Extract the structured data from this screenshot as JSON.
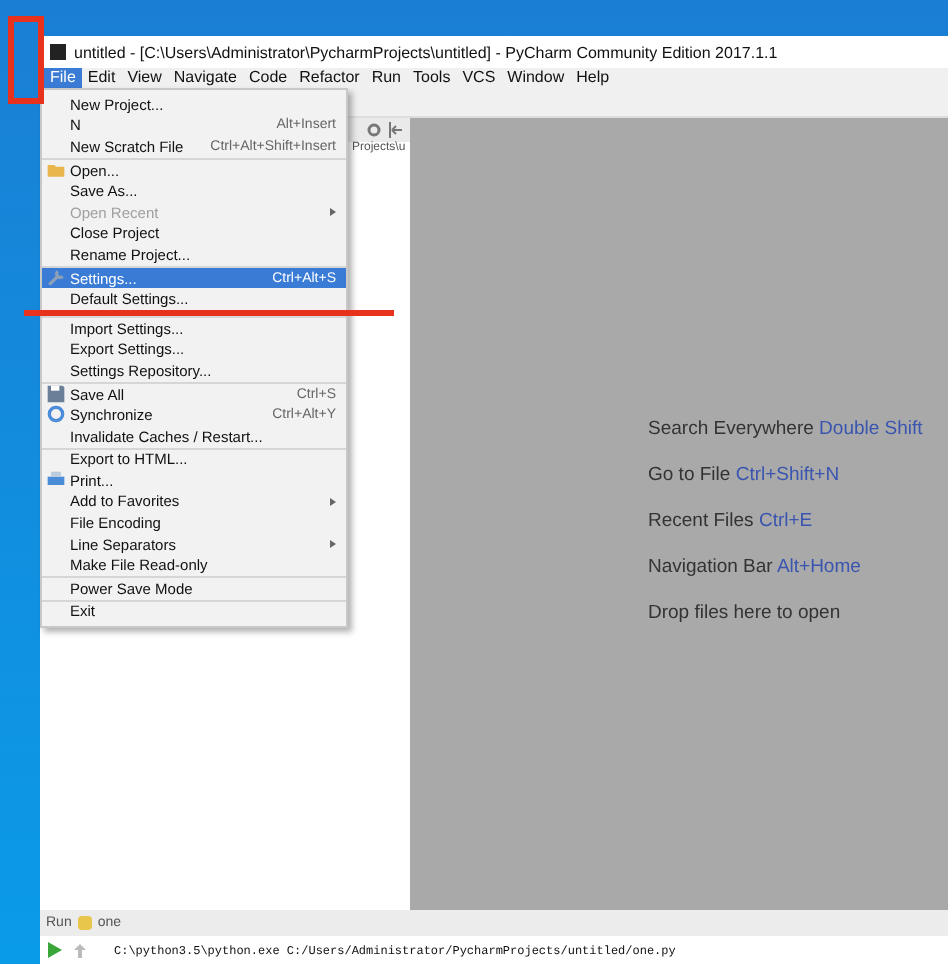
{
  "window": {
    "title": "untitled - [C:\\Users\\Administrator\\PycharmProjects\\untitled] - PyCharm Community Edition 2017.1.1"
  },
  "menubar": [
    {
      "label": "File",
      "selected": true
    },
    {
      "label": "Edit",
      "selected": false
    },
    {
      "label": "View",
      "selected": false
    },
    {
      "label": "Navigate",
      "selected": false
    },
    {
      "label": "Code",
      "selected": false
    },
    {
      "label": "Refactor",
      "selected": false
    },
    {
      "label": "Run",
      "selected": false
    },
    {
      "label": "Tools",
      "selected": false
    },
    {
      "label": "VCS",
      "selected": false
    },
    {
      "label": "Window",
      "selected": false
    },
    {
      "label": "Help",
      "selected": false
    }
  ],
  "file_menu": [
    {
      "items": [
        {
          "label": "New Project...",
          "selected": false,
          "disabled": false,
          "submenu": false
        },
        {
          "label": "N",
          "shortcut": "Alt+Insert",
          "selected": false,
          "disabled": false,
          "submenu": false
        },
        {
          "label": "New Scratch File",
          "shortcut": "Ctrl+Alt+Shift+Insert",
          "selected": false,
          "disabled": false,
          "submenu": false
        }
      ]
    },
    {
      "items": [
        {
          "label": "Open...",
          "selected": false,
          "disabled": false,
          "submenu": false
        },
        {
          "label": "Save As...",
          "selected": false,
          "disabled": false,
          "submenu": false
        },
        {
          "label": "Open Recent",
          "selected": false,
          "disabled": true,
          "submenu": true
        },
        {
          "label": "Close Project",
          "selected": false,
          "disabled": false,
          "submenu": false
        },
        {
          "label": "Rename Project...",
          "selected": false,
          "disabled": false,
          "submenu": false
        }
      ]
    },
    {
      "items": [
        {
          "label": "Settings...",
          "shortcut": "Ctrl+Alt+S",
          "selected": true,
          "disabled": false,
          "submenu": false
        },
        {
          "label": "Default Settings...",
          "selected": false,
          "disabled": false,
          "submenu": false
        }
      ]
    },
    {
      "items": [
        {
          "label": "Import Settings...",
          "selected": false,
          "disabled": false,
          "submenu": false
        },
        {
          "label": "Export Settings...",
          "selected": false,
          "disabled": false,
          "submenu": false
        },
        {
          "label": "Settings Repository...",
          "selected": false,
          "disabled": false,
          "submenu": false
        }
      ]
    },
    {
      "items": [
        {
          "label": "Save All",
          "shortcut": "Ctrl+S",
          "selected": false,
          "disabled": false,
          "submenu": false
        },
        {
          "label": "Synchronize",
          "shortcut": "Ctrl+Alt+Y",
          "selected": false,
          "disabled": false,
          "submenu": false
        },
        {
          "label": "Invalidate Caches / Restart...",
          "selected": false,
          "disabled": false,
          "submenu": false
        }
      ]
    },
    {
      "items": [
        {
          "label": "Export to HTML...",
          "selected": false,
          "disabled": false,
          "submenu": false
        },
        {
          "label": "Print...",
          "selected": false,
          "disabled": false,
          "submenu": false
        },
        {
          "label": "Add to Favorites",
          "selected": false,
          "disabled": false,
          "submenu": true
        },
        {
          "label": "File Encoding",
          "selected": false,
          "disabled": false,
          "submenu": false
        },
        {
          "label": "Line Separators",
          "selected": false,
          "disabled": false,
          "submenu": true
        },
        {
          "label": "Make File Read-only",
          "selected": false,
          "disabled": false,
          "submenu": false
        }
      ]
    },
    {
      "items": [
        {
          "label": "Power Save Mode",
          "selected": false,
          "disabled": false,
          "submenu": false
        }
      ]
    },
    {
      "items": [
        {
          "label": "Exit",
          "selected": false,
          "disabled": false,
          "submenu": false
        }
      ]
    }
  ],
  "project_panel": {
    "path": "Projects\\u"
  },
  "editor_hints": [
    {
      "action": "Search Everywhere",
      "shortcut": "Double Shift"
    },
    {
      "action": "Go to File",
      "shortcut": "Ctrl+Shift+N"
    },
    {
      "action": "Recent Files",
      "shortcut": "Ctrl+E"
    },
    {
      "action": "Navigation Bar",
      "shortcut": "Alt+Home"
    },
    {
      "action": "Drop files here to open"
    }
  ],
  "run_panel": {
    "label": "Run",
    "config": "one",
    "console_line": "C:\\python3.5\\python.exe C:/Users/Administrator/PycharmProjects/untitled/one.py"
  }
}
